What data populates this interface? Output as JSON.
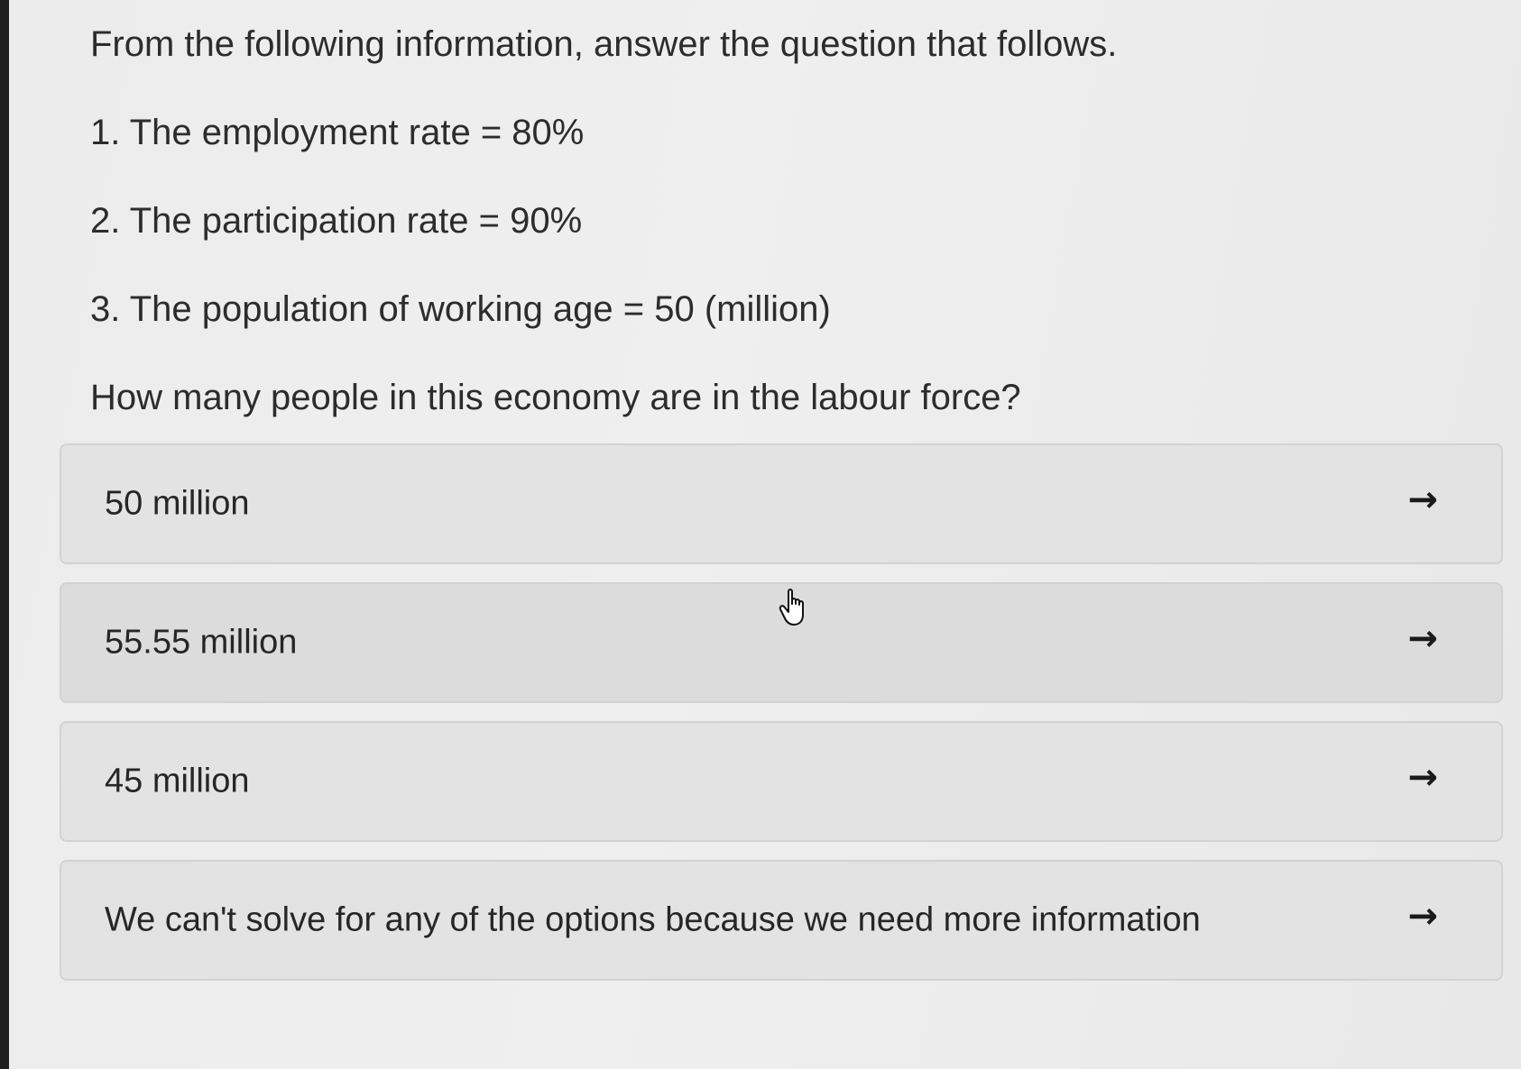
{
  "question": {
    "intro": "From the following information, answer the question that follows.",
    "facts": [
      "1. The employment rate = 80%",
      "2. The participation rate = 90%",
      "3. The population of working age = 50 (million)"
    ],
    "prompt": "How many people in this economy are in the labour force?"
  },
  "options": [
    {
      "label": "50 million",
      "icon": "arrow-right-icon"
    },
    {
      "label": "55.55 million",
      "icon": "arrow-right-icon"
    },
    {
      "label": "45 million",
      "icon": "arrow-right-icon"
    },
    {
      "label": "We can't solve for any of the options because we need more information",
      "icon": "arrow-right-icon"
    }
  ],
  "cursor": {
    "icon": "hand-pointer-icon"
  }
}
